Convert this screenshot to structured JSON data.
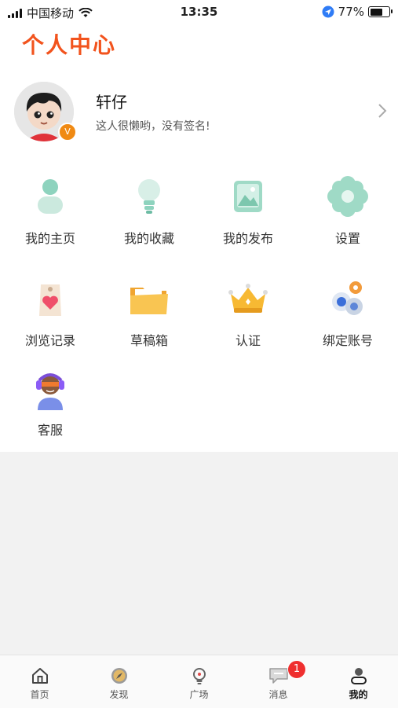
{
  "status_bar": {
    "carrier": "中国移动",
    "time": "13:35",
    "battery": "77%",
    "battery_level": 0.77
  },
  "page": {
    "title": "个人中心"
  },
  "profile": {
    "name": "轩仔",
    "signature": "这人很懒哟，没有签名!"
  },
  "menu": [
    {
      "label": "我的主页",
      "icon": "user-icon"
    },
    {
      "label": "我的收藏",
      "icon": "lightbulb-icon"
    },
    {
      "label": "我的发布",
      "icon": "image-icon"
    },
    {
      "label": "设置",
      "icon": "flower-settings-icon"
    },
    {
      "label": "浏览记录",
      "icon": "tag-heart-icon"
    },
    {
      "label": "草稿箱",
      "icon": "folder-icon"
    },
    {
      "label": "认证",
      "icon": "crown-icon"
    },
    {
      "label": "绑定账号",
      "icon": "linked-accounts-icon"
    },
    {
      "label": "客服",
      "icon": "support-agent-icon"
    }
  ],
  "tabbar": {
    "items": [
      {
        "label": "首页",
        "icon": "home-icon"
      },
      {
        "label": "发现",
        "icon": "compass-icon"
      },
      {
        "label": "广场",
        "icon": "bulb-square-icon"
      },
      {
        "label": "消息",
        "icon": "message-icon",
        "badge": "1"
      },
      {
        "label": "我的",
        "icon": "profile-icon",
        "active": true
      }
    ]
  },
  "colors": {
    "accent": "#f2531d",
    "icon_green": "#8ed3be",
    "badge_red": "#ef2f2f",
    "verify_orange": "#f08a13"
  }
}
